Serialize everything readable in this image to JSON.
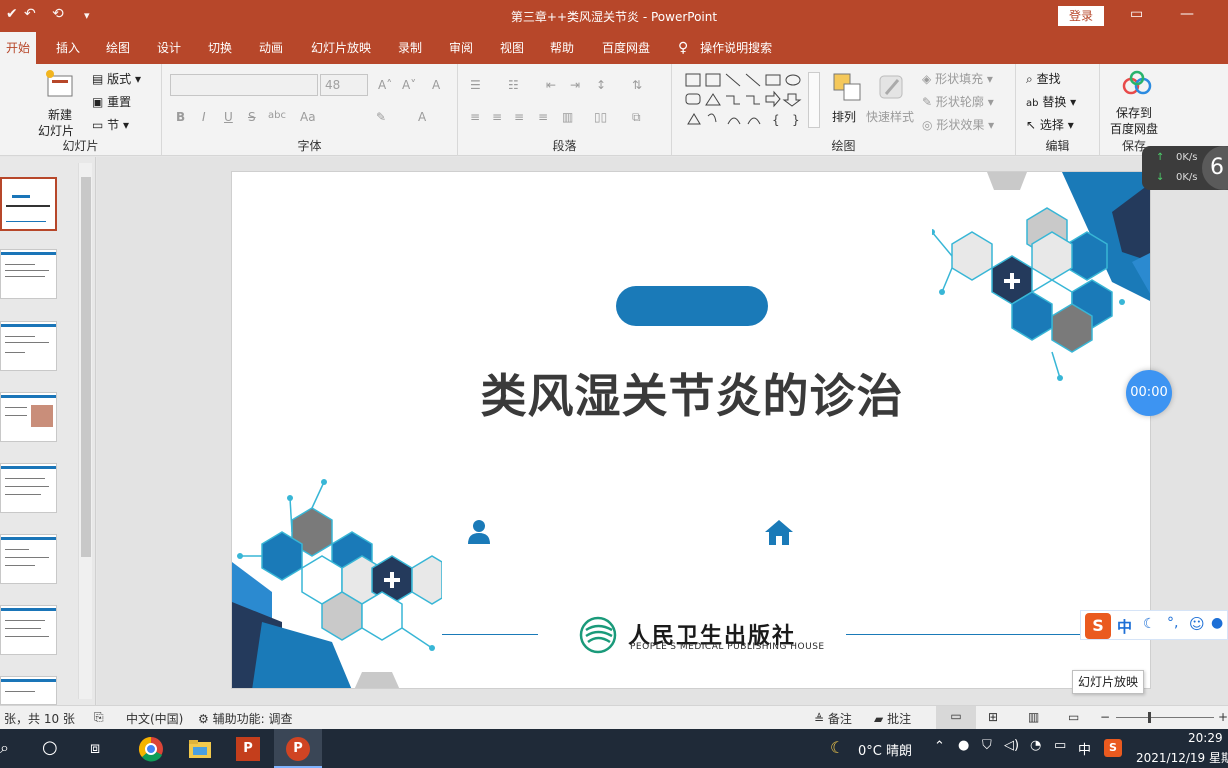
{
  "window": {
    "title": "第三章++类风湿关节炎  -  PowerPoint",
    "login_label": "登录"
  },
  "tabs": [
    "开始",
    "插入",
    "绘图",
    "设计",
    "切换",
    "动画",
    "幻灯片放映",
    "录制",
    "审阅",
    "视图",
    "帮助",
    "百度网盘"
  ],
  "tell_me": "操作说明搜索",
  "ribbon": {
    "slides_group": {
      "label": "幻灯片",
      "new_slide_line1": "新建",
      "new_slide_line2": "幻灯片",
      "layout": "版式",
      "reset": "重置",
      "section": "节"
    },
    "font_group": {
      "label": "字体",
      "size_value": "48",
      "bold": "B",
      "italic": "I",
      "underline": "U",
      "strike": "S",
      "spacing": "abc",
      "case": "Aa"
    },
    "paragraph_group": {
      "label": "段落"
    },
    "drawing_group": {
      "label": "绘图",
      "arrange": "排列",
      "quick_styles": "快速样式",
      "shape_fill": "形状填充",
      "shape_outline": "形状轮廓",
      "shape_effects": "形状效果"
    },
    "editing_group": {
      "label": "编辑",
      "find": "查找",
      "replace": "替换",
      "select": "选择"
    },
    "save_group": {
      "label": "保存",
      "save_line1": "保存到",
      "save_line2": "百度网盘"
    }
  },
  "slide": {
    "title": "类风湿关节炎的诊治",
    "publisher_cn": "人民卫生出版社",
    "publisher_en": "PEOPLE'S MEDICAL PUBLISHING HOUSE"
  },
  "widgets": {
    "net_up": "0K/s",
    "net_down": "0K/s",
    "net_badge": "6",
    "timer": "00:00",
    "ime_lang": "中",
    "tooltip": "幻灯片放映"
  },
  "status": {
    "slide_count": "张，共 10 张",
    "language": "中文(中国)",
    "accessibility": "辅助功能: 调查",
    "notes": "备注",
    "comments": "批注"
  },
  "taskbar": {
    "weather": "0°C  晴朗",
    "ime": "中",
    "time": "20:29",
    "date": "2021/12/19 星期"
  },
  "colors": {
    "accent": "#b7472a",
    "slide_blue": "#1a7ab8",
    "slide_dark": "#243a5c"
  }
}
